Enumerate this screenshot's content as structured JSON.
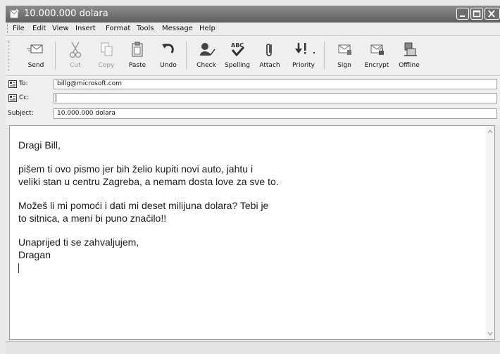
{
  "window": {
    "title": "10.000.000 dolara"
  },
  "menu": {
    "items": [
      "File",
      "Edit",
      "View",
      "Insert",
      "Format",
      "Tools",
      "Message",
      "Help"
    ]
  },
  "toolbar": {
    "buttons": [
      {
        "label": "Send",
        "icon": "send-icon",
        "enabled": true
      },
      {
        "label": "Cut",
        "icon": "scissors-icon",
        "enabled": false
      },
      {
        "label": "Copy",
        "icon": "copy-icon",
        "enabled": false
      },
      {
        "label": "Paste",
        "icon": "paste-icon",
        "enabled": true
      },
      {
        "label": "Undo",
        "icon": "undo-icon",
        "enabled": true
      },
      {
        "label": "Check",
        "icon": "check-names-icon",
        "enabled": true
      },
      {
        "label": "Spelling",
        "icon": "spelling-icon",
        "enabled": true
      },
      {
        "label": "Attach",
        "icon": "paperclip-icon",
        "enabled": true
      },
      {
        "label": "Priority",
        "icon": "priority-icon",
        "enabled": true
      },
      {
        "label": "Sign",
        "icon": "sign-icon",
        "enabled": true
      },
      {
        "label": "Encrypt",
        "icon": "encrypt-icon",
        "enabled": true
      },
      {
        "label": "Offline",
        "icon": "offline-icon",
        "enabled": true
      }
    ]
  },
  "header": {
    "to_label": "To:",
    "to_value": "billg@microsoft.com",
    "cc_label": "Cc:",
    "cc_value": "",
    "subject_label": "Subject:",
    "subject_value": "10.000.000 dolara"
  },
  "message": {
    "greeting": "Dragi Bill,",
    "paragraph1": "pišem ti ovo pismo jer bih želio kupiti novi auto, jahtu i\nveliki stan u centru Zagreba, a nemam dosta love za sve to.",
    "paragraph2": "Možeš li mi pomoći i dati mi deset milijuna dolara? Tebi je\nto sitnica, a meni bi puno značilo!!",
    "closing": "Unaprijed ti se zahvaljujem,\nDragan"
  }
}
